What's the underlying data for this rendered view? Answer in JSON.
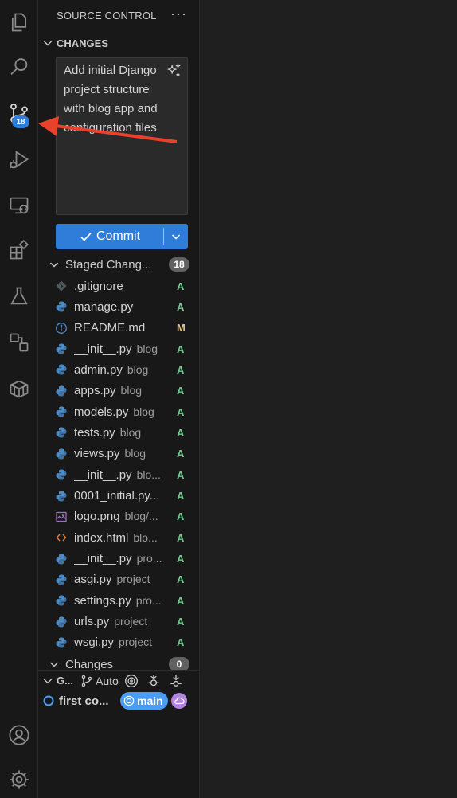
{
  "sidebar": {
    "title": "SOURCE CONTROL",
    "more": "···",
    "changes_section": "CHANGES",
    "commit_message": "Add initial Django project structure with blog app and configuration files",
    "commit_button": "Commit",
    "staged_group": {
      "label": "Staged Chang...",
      "count": "18"
    },
    "changes_group": {
      "label": "Changes",
      "count": "0"
    },
    "staged_files": [
      {
        "name": ".gitignore",
        "dir": "",
        "status": "A",
        "icon": "git-icon"
      },
      {
        "name": "manage.py",
        "dir": "",
        "status": "A",
        "icon": "python-icon"
      },
      {
        "name": "README.md",
        "dir": "",
        "status": "M",
        "icon": "info-icon"
      },
      {
        "name": "__init__.py",
        "dir": "blog",
        "status": "A",
        "icon": "python-icon"
      },
      {
        "name": "admin.py",
        "dir": "blog",
        "status": "A",
        "icon": "python-icon"
      },
      {
        "name": "apps.py",
        "dir": "blog",
        "status": "A",
        "icon": "python-icon"
      },
      {
        "name": "models.py",
        "dir": "blog",
        "status": "A",
        "icon": "python-icon"
      },
      {
        "name": "tests.py",
        "dir": "blog",
        "status": "A",
        "icon": "python-icon"
      },
      {
        "name": "views.py",
        "dir": "blog",
        "status": "A",
        "icon": "python-icon"
      },
      {
        "name": "__init__.py",
        "dir": "blo...",
        "status": "A",
        "icon": "python-icon"
      },
      {
        "name": "0001_initial.py...",
        "dir": "",
        "status": "A",
        "icon": "python-icon"
      },
      {
        "name": "logo.png",
        "dir": "blog/...",
        "status": "A",
        "icon": "image-icon"
      },
      {
        "name": "index.html",
        "dir": "blo...",
        "status": "A",
        "icon": "html-icon"
      },
      {
        "name": "__init__.py",
        "dir": "pro...",
        "status": "A",
        "icon": "python-icon"
      },
      {
        "name": "asgi.py",
        "dir": "project",
        "status": "A",
        "icon": "python-icon"
      },
      {
        "name": "settings.py",
        "dir": "pro...",
        "status": "A",
        "icon": "python-icon"
      },
      {
        "name": "urls.py",
        "dir": "project",
        "status": "A",
        "icon": "python-icon"
      },
      {
        "name": "wsgi.py",
        "dir": "project",
        "status": "A",
        "icon": "python-icon"
      }
    ],
    "graph": {
      "label": "G...",
      "branch_mode": "Auto",
      "commit_label": "first co...",
      "branch": "main"
    }
  },
  "activity_bar": {
    "scm_badge": "18",
    "items": [
      "explorer-icon",
      "search-icon",
      "source-control-icon",
      "run-debug-icon",
      "remote-explorer-icon",
      "extensions-icon",
      "testing-icon",
      "deployments-icon",
      "container-icon",
      "account-icon",
      "settings-gear-icon"
    ]
  },
  "colors": {
    "accent": "#2f7dd8",
    "added": "#73c991",
    "modified": "#e2c08d",
    "annotation_arrow": "#e8412c"
  }
}
